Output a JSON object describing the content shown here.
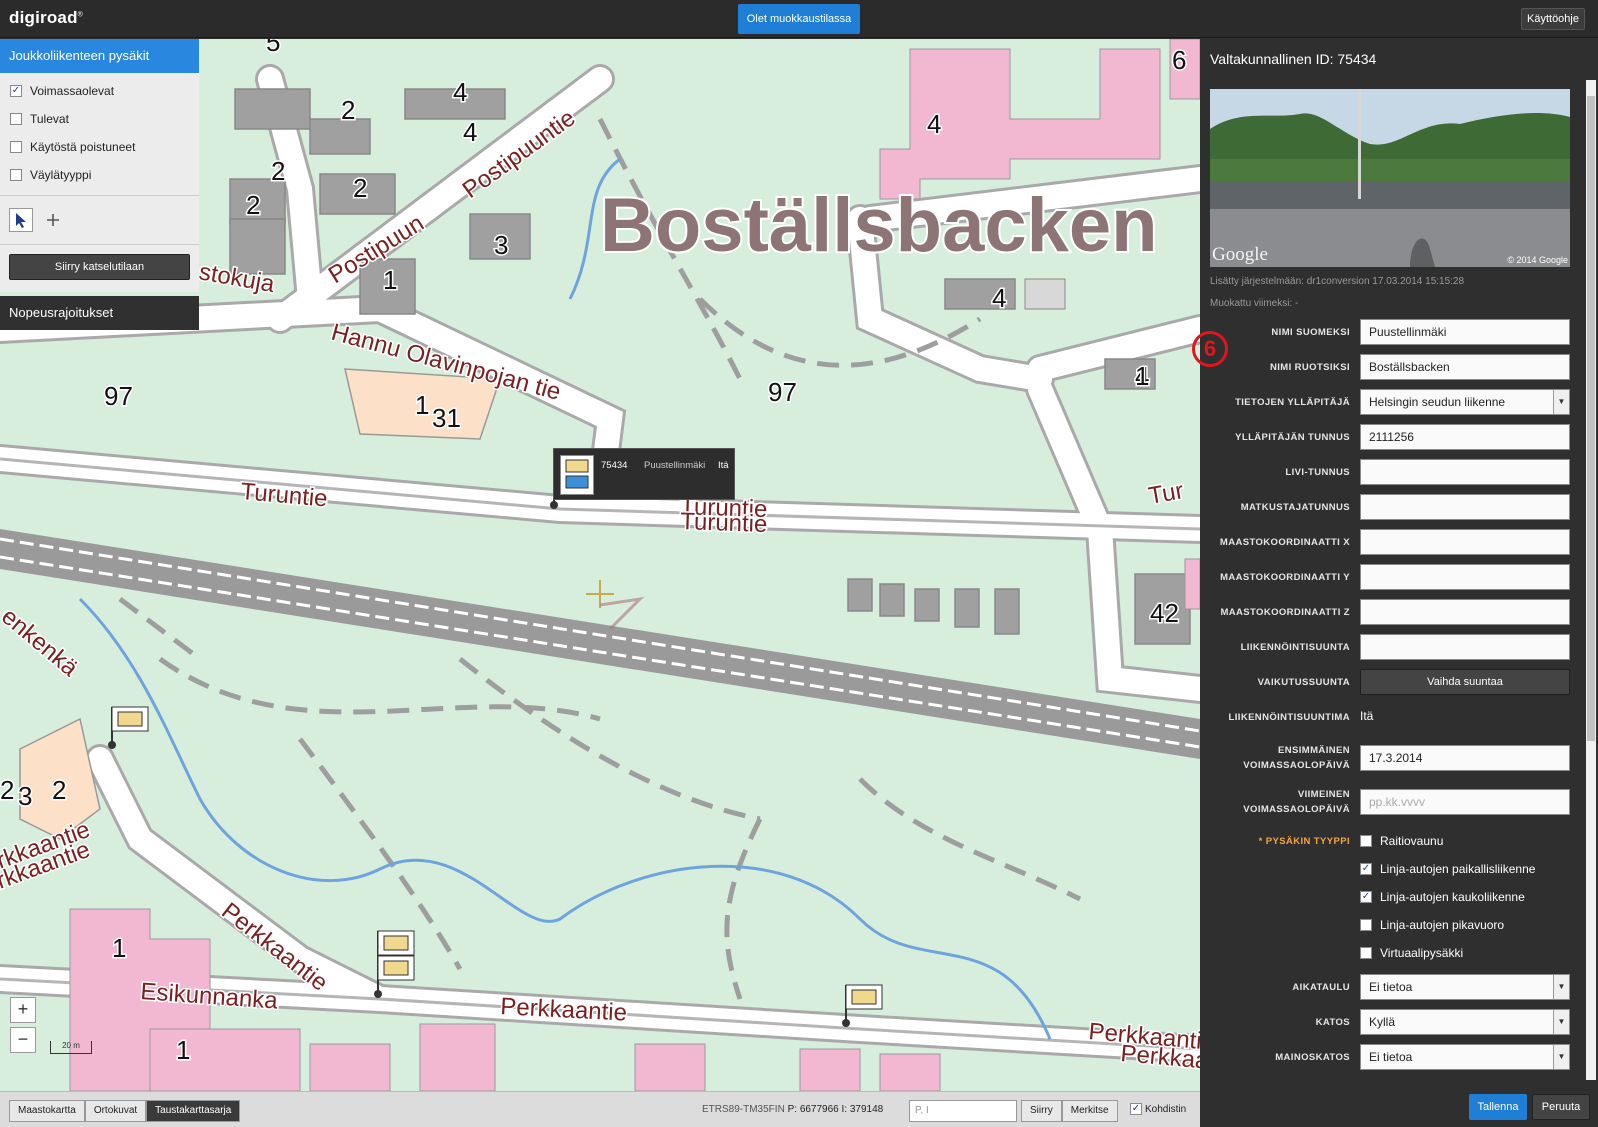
{
  "app": {
    "logo": "digiroad",
    "logo_mark": "®",
    "edit_mode": "Olet muokkaustilassa",
    "help": "Käyttöohje"
  },
  "layers": {
    "title": "Joukkoliikenteen pysäkit",
    "filters": [
      {
        "label": "Voimassaolevat",
        "checked": true
      },
      {
        "label": "Tulevat",
        "checked": false
      },
      {
        "label": "Käytöstä poistuneet",
        "checked": false
      },
      {
        "label": "Väylätyyppi",
        "checked": false
      }
    ],
    "view_mode_button": "Siirry katselutilaan",
    "speed_limits": "Nopeusrajoitukset"
  },
  "map": {
    "place_name": "Boställsbacken",
    "roads": [
      "Postipuuntie",
      "Postipuun",
      "Hannu Olavinpojan tie",
      "Turuntie",
      "Turuntie",
      "Turuntie",
      "Tur",
      "Perkkaantie",
      "Perkkaantie",
      "Esikunnanka",
      "Perkkaantie",
      "Perkkaar",
      "stokuja",
      "enkenkä",
      "rkkaantie",
      "rkkaantie"
    ],
    "numbers": [
      "5",
      "4",
      "2",
      "4",
      "4",
      "2",
      "2",
      "2",
      "3",
      "1",
      "4",
      "6",
      "4",
      "1",
      "97",
      "97",
      "1",
      "31",
      "42",
      "2",
      "3",
      "2",
      "1",
      "1"
    ],
    "popup": {
      "id": "75434",
      "name": "Puustellinmäki",
      "direction": "Itä"
    },
    "zoom_in": "+",
    "zoom_out": "−",
    "scale": "20 m"
  },
  "bottom": {
    "basemaps": [
      {
        "label": "Maastokartta",
        "active": false
      },
      {
        "label": "Ortokuvat",
        "active": false
      },
      {
        "label": "Taustakarttasarja",
        "active": true
      }
    ],
    "crs": "ETRS89-TM35FIN",
    "p_label": "P:",
    "p_value": "6677966",
    "i_label": "I:",
    "i_value": "379148",
    "coord_placeholder": "P, I",
    "move_btn": "Siirry",
    "mark_btn": "Merkitse",
    "target_label": "Kohdistin",
    "target_checked": true
  },
  "side": {
    "title": "Valtakunnallinen ID: 75434",
    "photo_copyright": "© 2014 Google",
    "photo_brand": "Google",
    "added": "Lisätty järjestelmään: dr1conversion 17.03.2014 15:15:28",
    "modified": "Muokattu viimeksi: -",
    "marker": "6",
    "fields": [
      {
        "label": "NIMI SUOMEKSI",
        "kind": "input",
        "value": "Puustellinmäki"
      },
      {
        "label": "NIMI RUOTSIKSI",
        "kind": "input",
        "value": "Boställsbacken"
      },
      {
        "label": "TIETOJEN YLLÄPITÄJÄ",
        "kind": "select",
        "value": "Helsingin seudun liikenne"
      },
      {
        "label": "YLLÄPITÄJÄN TUNNUS",
        "kind": "input",
        "value": "2111256"
      },
      {
        "label": "LIVI-TUNNUS",
        "kind": "input",
        "value": ""
      },
      {
        "label": "MATKUSTAJATUNNUS",
        "kind": "input",
        "value": ""
      },
      {
        "label": "MAASTOKOORDINAATTI X",
        "kind": "input",
        "value": ""
      },
      {
        "label": "MAASTOKOORDINAATTI Y",
        "kind": "input",
        "value": ""
      },
      {
        "label": "MAASTOKOORDINAATTI Z",
        "kind": "input",
        "value": ""
      },
      {
        "label": "LIIKENNÖINTISUUNTA",
        "kind": "input",
        "value": ""
      },
      {
        "label": "VAIKUTUSSUUNTA",
        "kind": "button",
        "value": "Vaihda suuntaa"
      },
      {
        "label": "LIIKENNÖINTISUUNTIMA",
        "kind": "text",
        "value": "Itä"
      },
      {
        "label": "ENSIMMÄINEN VOIMASSAOLOPÄIVÄ",
        "kind": "input",
        "value": "17.3.2014"
      },
      {
        "label": "VIIMEINEN VOIMASSAOLOPÄIVÄ",
        "kind": "placeholder",
        "value": "pp.kk.vvvv"
      }
    ],
    "stop_type_label": "* PYSÄKIN TYYPPI",
    "stop_types": [
      {
        "label": "Raitiovaunu",
        "checked": false
      },
      {
        "label": "Linja-autojen paikallisliikenne",
        "checked": true
      },
      {
        "label": "Linja-autojen kaukoliikenne",
        "checked": true
      },
      {
        "label": "Linja-autojen pikavuoro",
        "checked": false
      },
      {
        "label": "Virtuaalipysäkki",
        "checked": false
      }
    ],
    "selects": [
      {
        "label": "AIKATAULU",
        "value": "Ei tietoa"
      },
      {
        "label": "KATOS",
        "value": "Kyllä"
      },
      {
        "label": "MAINOSKATOS",
        "value": "Ei tietoa"
      }
    ],
    "save": "Tallenna",
    "cancel": "Peruuta"
  },
  "colors": {
    "accent": "#1f7ed6",
    "panel": "#2f2f2f",
    "map_bg": "#d7eedd",
    "road_label": "#7a1f1f",
    "marker": "#e0161c"
  }
}
